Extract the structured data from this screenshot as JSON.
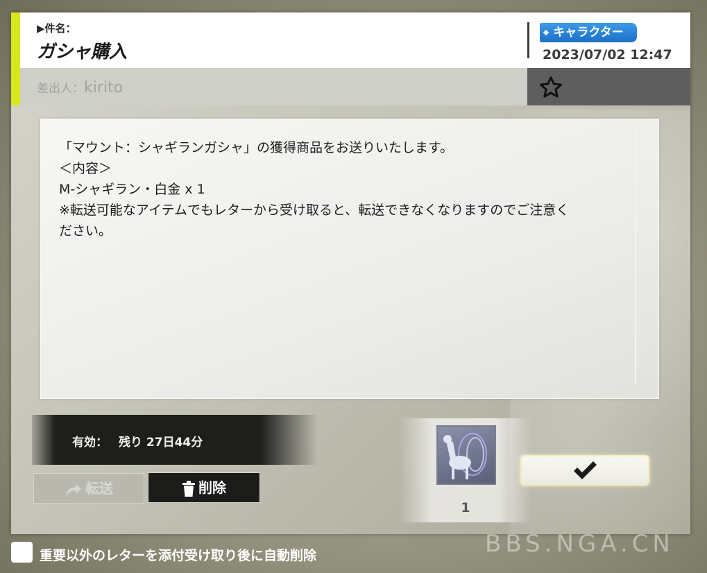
{
  "header": {
    "subject_label": "▶件名：",
    "subject_title": "ガシャ購入",
    "category_tag": "キャラクター",
    "date": "2023/07/02 12:47"
  },
  "sender": {
    "prefix": "差出人：",
    "name": "kirito"
  },
  "body": {
    "lines": [
      "「マウント：シャギランガシャ」の獲得商品をお送りいたします。",
      "＜内容＞",
      "M-シャギラン・白金 x 1",
      "※転送可能なアイテムでもレターから受け取ると、転送できなくなりますのでご注意く",
      "ださい。"
    ]
  },
  "expiry": {
    "label": "有効：",
    "value": "残り 27日44分"
  },
  "buttons": {
    "forward": "転送",
    "delete": "削除"
  },
  "attachment": {
    "count": "1"
  },
  "footer": {
    "auto_delete_label": "重要以外のレターを添付受け取り後に自動削除"
  },
  "watermark": "BBS.NGA.CN",
  "icons": [
    "star-icon",
    "forward-arrow-icon",
    "trash-icon",
    "check-icon",
    "mount-item-icon"
  ],
  "colors": {
    "accent": "#d8e61c",
    "tag": "#2a86d9",
    "delete_button": "#1c1c1a"
  }
}
